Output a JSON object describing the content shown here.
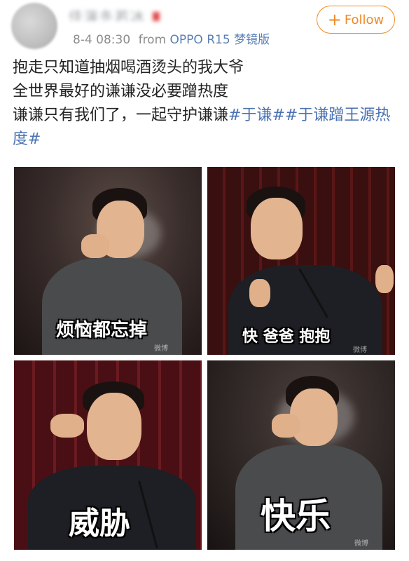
{
  "header": {
    "username": "佳演冬若冰",
    "time": "8-4 08:30",
    "from_label": "from",
    "device": "OPPO R15 梦镜版",
    "follow_label": "Follow"
  },
  "post": {
    "line1": "抱走只知道抽烟喝酒烫头的我大爷",
    "line2": "全世界最好的谦谦没必要蹭热度",
    "line3_text": "谦谦只有我们了，一起守护谦谦",
    "tag1": "#于谦#",
    "tag2": "#于谦蹭王源热度#"
  },
  "images": [
    {
      "caption": "烦恼都忘掉",
      "watermark": "微博"
    },
    {
      "caption": "快 爸爸 抱抱",
      "watermark": "微博"
    },
    {
      "caption": "威胁",
      "watermark": ""
    },
    {
      "caption": "快乐",
      "watermark": "微博"
    }
  ],
  "colors": {
    "follow_accent": "#f08a24",
    "hashtag": "#4a72b2",
    "meta_gray": "#8c8c8c"
  },
  "icons": {
    "follow": "plus-icon"
  }
}
